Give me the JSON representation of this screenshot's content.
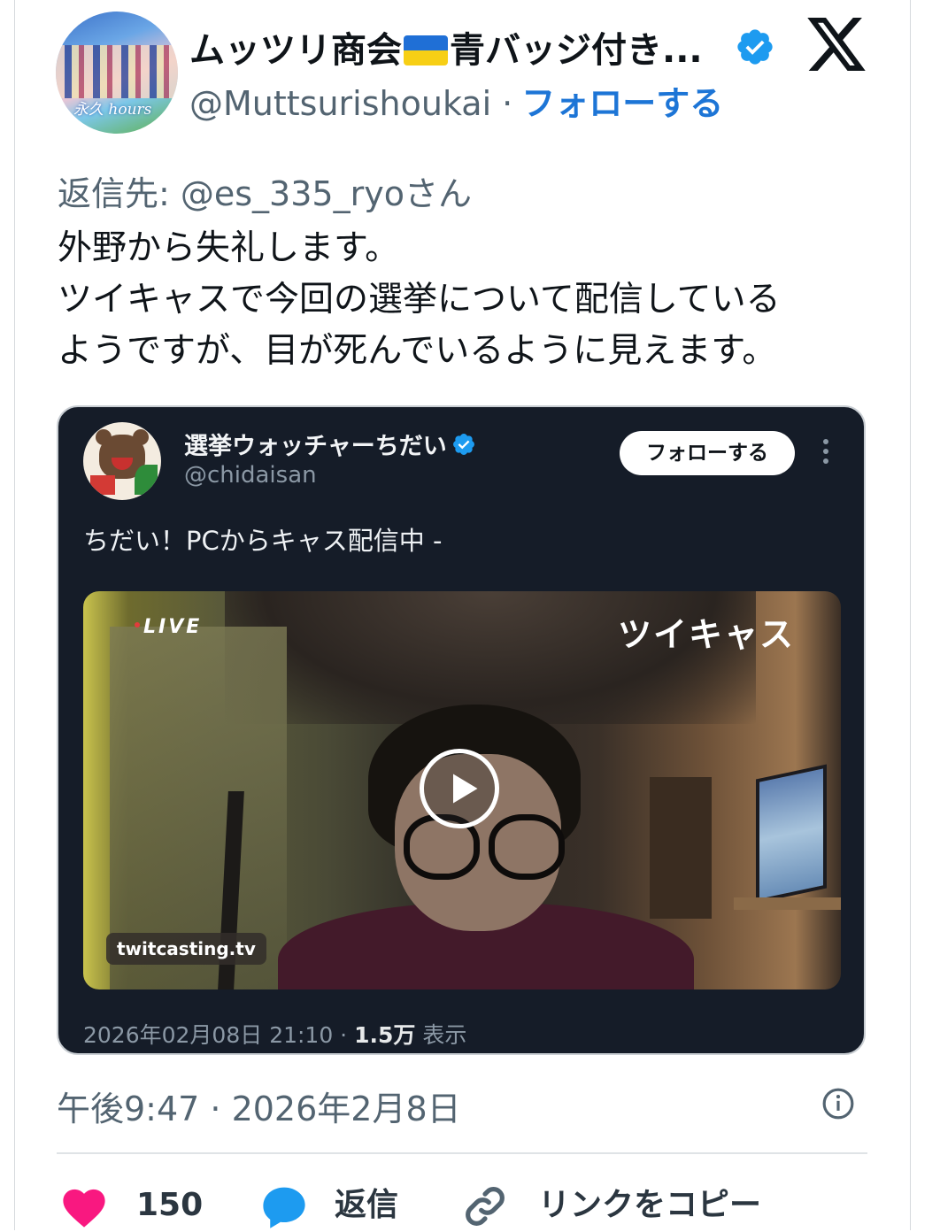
{
  "author": {
    "name_part1": "ムッツリ商会",
    "name_part2": "青バッジ付き...",
    "handle": "@Muttsurishoukai",
    "separator": "·",
    "follow_label": "フォローする",
    "avatar_text": "永久 hours"
  },
  "tweet": {
    "reply_to": "返信先: @es_335_ryoさん",
    "lines": [
      "外野から失礼します。",
      "ツイキャスで今回の選挙について配信している",
      "ようですが、目が死んでいるように見えます。"
    ],
    "timestamp": "午後9:47 · 2026年2月8日"
  },
  "embedded": {
    "name": "選挙ウォッチャーちだい",
    "handle": "@chidaisan",
    "follow_label": "フォローする",
    "text": "ちだい！PCからキャス配信中 -",
    "video": {
      "live_label": "LIVE",
      "brand": "ツイキャス",
      "source": "twitcasting.tv"
    },
    "meta_date": "2026年02月08日 21:10 · ",
    "meta_views": "1.5万",
    "meta_views_label": " 表示"
  },
  "actions": {
    "like_count": "150",
    "reply_label": "返信",
    "copy_label": "リンクをコピー"
  },
  "colors": {
    "accent": "#1d75d6",
    "like": "#f91880",
    "reply": "#1d9bf0",
    "verified": "#1d9bf0",
    "embed_bg": "#151c28"
  },
  "icons": [
    "verified-badge-icon",
    "x-logo-icon",
    "more-icon",
    "play-icon",
    "info-icon",
    "heart-icon",
    "reply-bubble-icon",
    "link-icon"
  ]
}
